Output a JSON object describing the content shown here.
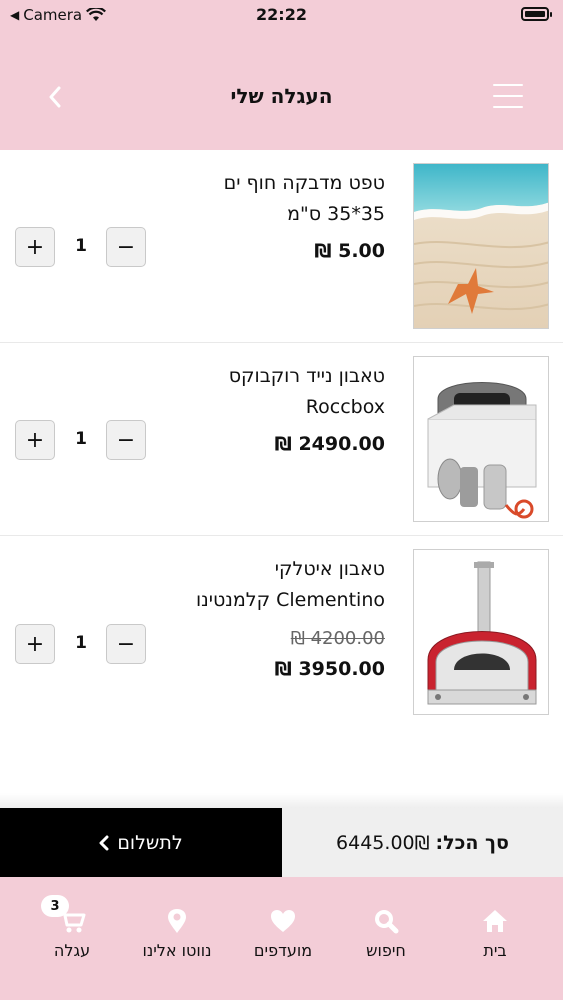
{
  "status_bar": {
    "carrier": "Camera",
    "time": "22:22"
  },
  "header": {
    "title": "העגלה שלי"
  },
  "cart_items": [
    {
      "name_line1": "טפט מדבקה חוף ים",
      "name_line2": "35*35 ס\"מ",
      "price": "5.00 ₪",
      "old_price": "",
      "quantity": "1"
    },
    {
      "name_line1": "טאבון נייד רוקבוקס",
      "name_line2": "Roccbox",
      "price": "2490.00 ₪",
      "old_price": "",
      "quantity": "1"
    },
    {
      "name_line1": "טאבון איטלקי",
      "name_line2": "Clementino קלמנטינו",
      "price": "3950.00 ₪",
      "old_price": "4200.00 ₪",
      "quantity": "1"
    }
  ],
  "checkout": {
    "pay_label": "לתשלום",
    "total_label": "סך הכל:",
    "total_value": "6445.00₪"
  },
  "tabbar": {
    "home": "בית",
    "search": "חיפוש",
    "favorites": "מועדפים",
    "navigate": "נווטו אלינו",
    "cart": "עגלה",
    "cart_count": "3"
  },
  "colors": {
    "header_bg": "#f3cdd7",
    "pay_bg": "#000000",
    "total_bg": "#efefef"
  },
  "icons": {
    "plus": "+",
    "minus": "−"
  }
}
